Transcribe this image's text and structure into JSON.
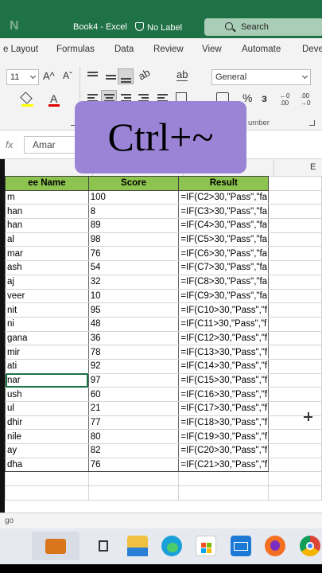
{
  "titlebar": {
    "document": "Book4 - Excel",
    "sensitivity_label": "No Label",
    "search_placeholder": "Search"
  },
  "menu": {
    "items": [
      "e Layout",
      "Formulas",
      "Data",
      "Review",
      "View",
      "Automate",
      "Deve"
    ]
  },
  "ribbon": {
    "font_size": "11",
    "grow_font": "A^",
    "shrink_font": "Aˇ",
    "number_format": "General",
    "percent": "%",
    "comma": "з",
    "number_group_label": "umber"
  },
  "formula_bar": {
    "fx_label": "fx",
    "name_value": "Amar"
  },
  "column_header": {
    "visible_letter": "E"
  },
  "table": {
    "headers": [
      "ee Name",
      "Score",
      "Result"
    ],
    "rows": [
      [
        "m",
        "100",
        "=IF(C2>30,\"Pass\",\"fa"
      ],
      [
        "han",
        "8",
        "=IF(C3>30,\"Pass\",\"fa"
      ],
      [
        "han",
        "89",
        "=IF(C4>30,\"Pass\",\"fa"
      ],
      [
        "al",
        "98",
        "=IF(C5>30,\"Pass\",\"fa"
      ],
      [
        "mar",
        "76",
        "=IF(C6>30,\"Pass\",\"fa"
      ],
      [
        "ash",
        "54",
        "=IF(C7>30,\"Pass\",\"fa"
      ],
      [
        "aj",
        "32",
        "=IF(C8>30,\"Pass\",\"fa"
      ],
      [
        "veer",
        "10",
        "=IF(C9>30,\"Pass\",\"fa"
      ],
      [
        "nit",
        "95",
        "=IF(C10>30,\"Pass\",\"f"
      ],
      [
        "ni",
        "48",
        "=IF(C11>30,\"Pass\",\"f"
      ],
      [
        "gana",
        "36",
        "=IF(C12>30,\"Pass\",\"f"
      ],
      [
        "mir",
        "78",
        "=IF(C13>30,\"Pass\",\"f"
      ],
      [
        "ati",
        "92",
        "=IF(C14>30,\"Pass\",\"f"
      ],
      [
        "nar",
        "97",
        "=IF(C15>30,\"Pass\",\"f"
      ],
      [
        "ush",
        "60",
        "=IF(C16>30,\"Pass\",\"f"
      ],
      [
        "ul",
        "21",
        "=IF(C17>30,\"Pass\",\"f"
      ],
      [
        "dhir",
        "77",
        "=IF(C18>30,\"Pass\",\"f"
      ],
      [
        "nile",
        "80",
        "=IF(C19>30,\"Pass\",\"f"
      ],
      [
        "ay",
        "82",
        "=IF(C20>30,\"Pass\",\"f"
      ],
      [
        "dha",
        "76",
        "=IF(C21>30,\"Pass\",\"f"
      ]
    ]
  },
  "status": {
    "text": "go"
  },
  "overlay": {
    "shortcut": "Ctrl+~"
  },
  "colors": {
    "excel_green": "#1f7146",
    "header_fill": "#8dc34f",
    "overlay_fill": "#9b84d6"
  },
  "taskbar": {
    "icons": [
      "briefcase-icon",
      "task-view-icon",
      "file-explorer-icon",
      "edge-icon",
      "store-icon",
      "mail-icon",
      "firefox-icon",
      "chrome-icon"
    ]
  }
}
